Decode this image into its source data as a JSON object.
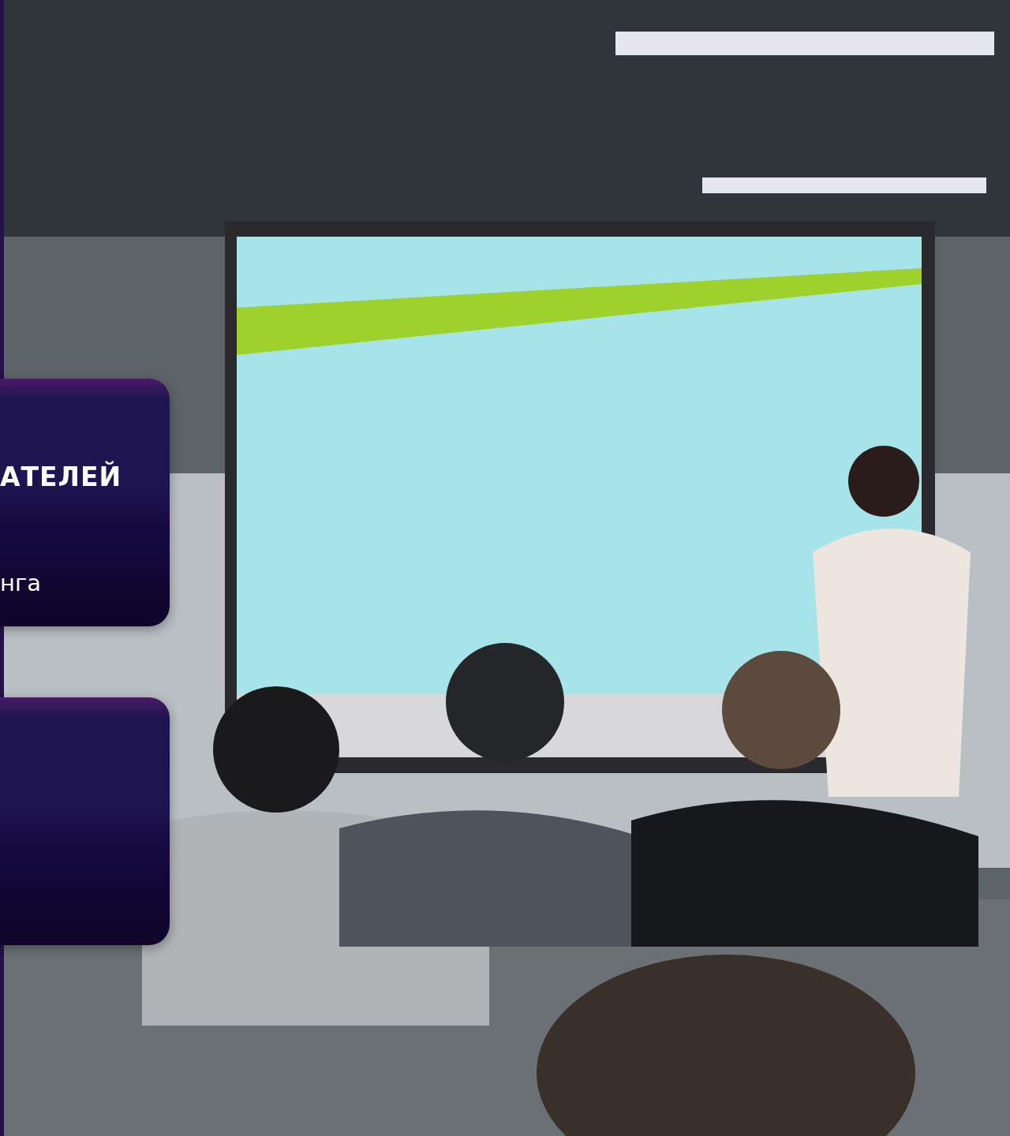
{
  "cards": [
    {
      "kind": "text",
      "title": "АТЕЛЕЙ",
      "text": "нга"
    },
    {
      "kind": "blank"
    }
  ]
}
